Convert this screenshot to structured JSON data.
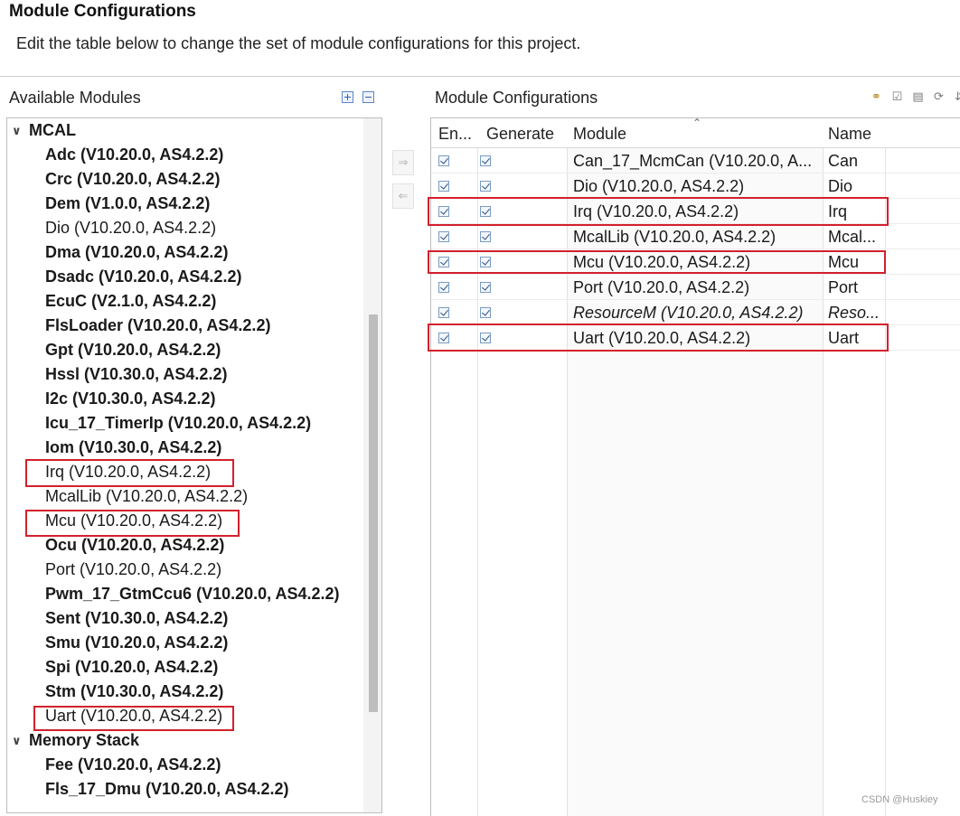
{
  "header": {
    "title": "Module Configurations",
    "description": "Edit the table below to change the set of module configurations for this project."
  },
  "left_panel": {
    "title": "Available Modules",
    "tools": [
      "expand-all-icon",
      "collapse-all-icon"
    ],
    "groups": [
      {
        "label": "MCAL",
        "expanded": true,
        "items": [
          {
            "label": "Adc (V10.20.0, AS4.2.2)",
            "bold": true
          },
          {
            "label": "Crc (V10.20.0, AS4.2.2)",
            "bold": true
          },
          {
            "label": "Dem (V1.0.0, AS4.2.2)",
            "bold": true
          },
          {
            "label": "Dio (V10.20.0, AS4.2.2)",
            "bold": false
          },
          {
            "label": "Dma (V10.20.0, AS4.2.2)",
            "bold": true
          },
          {
            "label": "Dsadc (V10.20.0, AS4.2.2)",
            "bold": true
          },
          {
            "label": "EcuC (V2.1.0, AS4.2.2)",
            "bold": true
          },
          {
            "label": "FlsLoader (V10.20.0, AS4.2.2)",
            "bold": true
          },
          {
            "label": "Gpt (V10.20.0, AS4.2.2)",
            "bold": true
          },
          {
            "label": "Hssl (V10.30.0, AS4.2.2)",
            "bold": true
          },
          {
            "label": "I2c (V10.30.0, AS4.2.2)",
            "bold": true
          },
          {
            "label": "Icu_17_TimerIp (V10.20.0, AS4.2.2)",
            "bold": true
          },
          {
            "label": "Iom (V10.30.0, AS4.2.2)",
            "bold": true
          },
          {
            "label": "Irq (V10.20.0, AS4.2.2)",
            "bold": false
          },
          {
            "label": "McalLib (V10.20.0, AS4.2.2)",
            "bold": false
          },
          {
            "label": "Mcu (V10.20.0, AS4.2.2)",
            "bold": false
          },
          {
            "label": "Ocu (V10.20.0, AS4.2.2)",
            "bold": true
          },
          {
            "label": "Port (V10.20.0, AS4.2.2)",
            "bold": false
          },
          {
            "label": "Pwm_17_GtmCcu6 (V10.20.0, AS4.2.2)",
            "bold": true
          },
          {
            "label": "Sent (V10.30.0, AS4.2.2)",
            "bold": true
          },
          {
            "label": "Smu (V10.20.0, AS4.2.2)",
            "bold": true
          },
          {
            "label": "Spi (V10.20.0, AS4.2.2)",
            "bold": true
          },
          {
            "label": "Stm (V10.30.0, AS4.2.2)",
            "bold": true
          },
          {
            "label": "Uart (V10.20.0, AS4.2.2)",
            "bold": false
          }
        ]
      },
      {
        "label": "Memory Stack",
        "expanded": true,
        "items": [
          {
            "label": "Fee (V10.20.0, AS4.2.2)",
            "bold": true
          },
          {
            "label": "Fls_17_Dmu (V10.20.0, AS4.2.2)",
            "bold": true
          }
        ]
      }
    ]
  },
  "middle_buttons": [
    "add-module-icon",
    "remove-module-icon"
  ],
  "right_panel": {
    "title": "Module Configurations",
    "tools": [
      "link-icon",
      "validate-icon",
      "paste-icon",
      "generate-icon",
      "more-icon"
    ],
    "columns": [
      "En...",
      "Generate",
      "Module",
      "Name"
    ],
    "rows": [
      {
        "enabled": true,
        "generate": true,
        "module": "Can_17_McmCan (V10.20.0, A...",
        "name": "Can",
        "italic": false
      },
      {
        "enabled": true,
        "generate": true,
        "module": "Dio (V10.20.0, AS4.2.2)",
        "name": "Dio",
        "italic": false
      },
      {
        "enabled": true,
        "generate": true,
        "module": "Irq (V10.20.0, AS4.2.2)",
        "name": "Irq",
        "italic": false
      },
      {
        "enabled": true,
        "generate": true,
        "module": "McalLib (V10.20.0, AS4.2.2)",
        "name": "Mcal...",
        "italic": false
      },
      {
        "enabled": true,
        "generate": true,
        "module": "Mcu (V10.20.0, AS4.2.2)",
        "name": "Mcu",
        "italic": false
      },
      {
        "enabled": true,
        "generate": true,
        "module": "Port (V10.20.0, AS4.2.2)",
        "name": "Port",
        "italic": false
      },
      {
        "enabled": true,
        "generate": true,
        "module": "ResourceM (V10.20.0, AS4.2.2)",
        "name": "Reso...",
        "italic": true
      },
      {
        "enabled": true,
        "generate": true,
        "module": "Uart (V10.20.0, AS4.2.2)",
        "name": "Uart",
        "italic": false
      }
    ]
  },
  "highlight_color": "#d3202c",
  "watermark": "CSDN @Huskiey"
}
